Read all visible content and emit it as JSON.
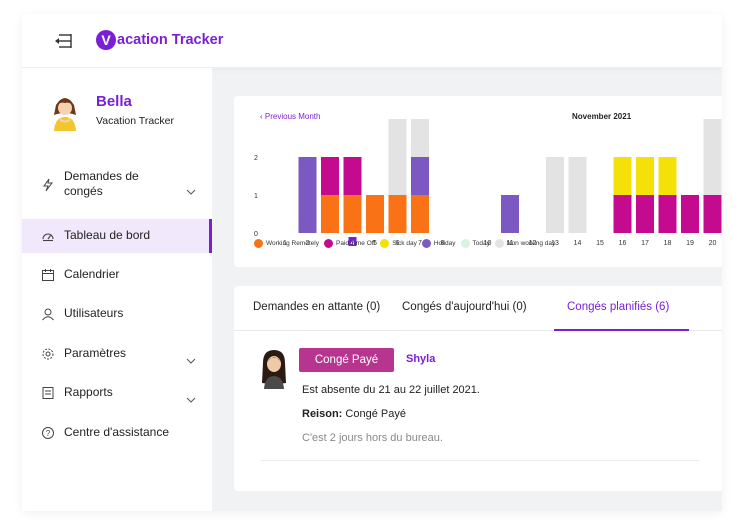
{
  "app": {
    "logo_letter": "V",
    "logo_text": "acation Tracker"
  },
  "user": {
    "name": "Bella",
    "subtitle": "Vacation Tracker"
  },
  "sidebar": {
    "items": [
      {
        "label": "Demandes de",
        "label2": "congés",
        "icon": "bolt-icon",
        "has_chevron": true
      },
      {
        "label": "Tableau de bord",
        "icon": "dashboard-icon",
        "active": true
      },
      {
        "label": "Calendrier",
        "icon": "calendar-icon"
      },
      {
        "label": "Utilisateurs",
        "icon": "user-icon"
      },
      {
        "label": "Paramètres",
        "icon": "gear-icon",
        "has_chevron": true
      },
      {
        "label": "Rapports",
        "icon": "report-icon",
        "has_chevron": true
      },
      {
        "label": "Centre d'assistance",
        "icon": "help-icon"
      }
    ]
  },
  "calendar": {
    "prev_label": "Previous Month",
    "month_title": "November 2021"
  },
  "colors": {
    "accent": "#7a1fd6",
    "working_remotely": "#f97316",
    "paid_time_off": "#c40a8f",
    "sick_day": "#f5e10a",
    "holiday": "#7c58c2",
    "today": "#d8f3e0",
    "non_working": "#e3e3e3"
  },
  "chart_data": {
    "type": "bar",
    "stacked": true,
    "categories": [
      "1",
      "2",
      "3",
      "4",
      "5",
      "6",
      "7",
      "8",
      "9",
      "10",
      "11",
      "12",
      "13",
      "14",
      "15",
      "16",
      "17",
      "18",
      "19",
      "20"
    ],
    "ylim": [
      0,
      2
    ],
    "yticks": [
      "0",
      "1",
      "2"
    ],
    "highlight_category": "4",
    "series": [
      {
        "name": "Working Remotely",
        "color": "#f97316",
        "values": [
          0,
          0,
          1,
          1,
          1,
          1,
          1,
          0,
          0,
          0,
          0,
          0,
          0,
          0,
          0,
          0,
          0,
          0,
          0,
          0
        ]
      },
      {
        "name": "Paid Time Off",
        "color": "#c40a8f",
        "values": [
          0,
          0,
          1,
          1,
          0,
          0,
          0,
          0,
          0,
          0,
          0,
          0,
          0,
          0,
          0,
          1,
          1,
          1,
          1,
          1
        ]
      },
      {
        "name": "Sick day",
        "color": "#f5e10a",
        "values": [
          0,
          0,
          0,
          0,
          0,
          0,
          0,
          0,
          0,
          0,
          0,
          0,
          0,
          0,
          0,
          1,
          1,
          1,
          0,
          0
        ]
      },
      {
        "name": "Holiday",
        "color": "#7c58c2",
        "values": [
          0,
          2,
          0,
          0,
          0,
          0,
          1,
          0,
          0,
          0,
          1,
          0,
          0,
          0,
          0,
          0,
          0,
          0,
          0,
          0
        ]
      },
      {
        "name": "Today",
        "color": "#d8f3e0",
        "values": [
          0,
          0,
          0,
          0,
          0,
          0,
          0,
          0,
          0,
          0,
          0,
          0,
          0,
          0,
          0,
          0,
          0,
          0,
          0,
          0
        ]
      },
      {
        "name": "Non working day",
        "color": "#e3e3e3",
        "values": [
          0,
          0,
          0,
          0,
          0,
          2,
          1,
          0,
          0,
          0,
          0,
          0,
          2,
          2,
          0,
          0,
          0,
          0,
          0,
          2
        ]
      }
    ]
  },
  "legend": [
    {
      "label": "Working Remotely",
      "color": "#f97316"
    },
    {
      "label": "Paid Time Off",
      "color": "#c40a8f"
    },
    {
      "label": "Sick day",
      "color": "#f5e10a"
    },
    {
      "label": "Holiday",
      "color": "#7c58c2"
    },
    {
      "label": "Today",
      "color": "#d8f3e0"
    },
    {
      "label": "Non working day",
      "color": "#e3e3e3"
    }
  ],
  "tabs": [
    {
      "label": "Demandes en attante (0)"
    },
    {
      "label": "Congés d'aujourd'hui (0)"
    },
    {
      "label": "Congés planifiés (6)",
      "active": true
    }
  ],
  "request": {
    "badge": "Congé Payé",
    "user": "Shyla",
    "line1": "Est absente du 21 au 22 juillet 2021.",
    "reason_label": "Reison:",
    "reason_value": " Congé Payé",
    "note": "C'est 2 jours hors du bureau."
  }
}
